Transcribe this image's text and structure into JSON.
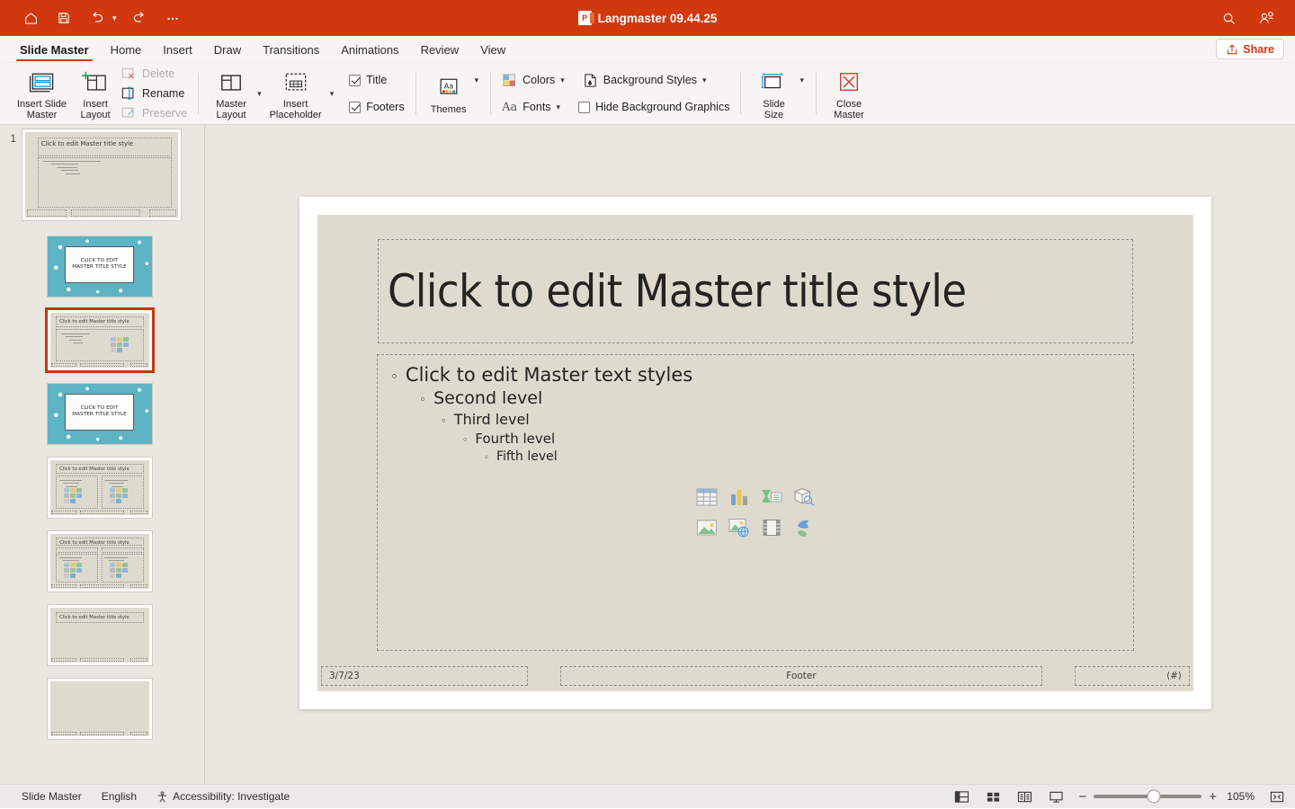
{
  "titlebar": {
    "title": "Langmaster 09.44.25",
    "logo_label": "P",
    "quick_access": [
      {
        "name": "home-icon",
        "label": "Home"
      },
      {
        "name": "save-icon",
        "label": "Save"
      },
      {
        "name": "undo-icon",
        "label": "Undo"
      },
      {
        "name": "redo-icon",
        "label": "Redo"
      },
      {
        "name": "more-options-icon",
        "label": "More Options"
      }
    ],
    "right_icons": [
      {
        "name": "search-icon",
        "label": "Search"
      },
      {
        "name": "account-icon",
        "label": "Account"
      }
    ]
  },
  "tabs": [
    {
      "label": "Slide Master",
      "active": true
    },
    {
      "label": "Home",
      "active": false
    },
    {
      "label": "Insert",
      "active": false
    },
    {
      "label": "Draw",
      "active": false
    },
    {
      "label": "Transitions",
      "active": false
    },
    {
      "label": "Animations",
      "active": false
    },
    {
      "label": "Review",
      "active": false
    },
    {
      "label": "View",
      "active": false
    }
  ],
  "share": {
    "label": "Share"
  },
  "ribbon": {
    "insert_slide_master": "Insert Slide\nMaster",
    "insert_layout": "Insert\nLayout",
    "delete": "Delete",
    "rename": "Rename",
    "preserve": "Preserve",
    "master_layout": "Master\nLayout",
    "insert_placeholder": "Insert\nPlaceholder",
    "title_checkbox": "Title",
    "title_checked": true,
    "footers_checkbox": "Footers",
    "footers_checked": true,
    "themes": "Themes",
    "colors": "Colors",
    "fonts": "Fonts",
    "background_styles": "Background Styles",
    "hide_background_graphics": "Hide Background Graphics",
    "hide_background_checked": false,
    "slide_size": "Slide\nSize",
    "close_master": "Close\nMaster"
  },
  "thumbnails": {
    "master_number": "1",
    "master_title": "Click to edit Master title style",
    "items": [
      {
        "name": "layout-title-slide",
        "type": "teal-title",
        "text": "CLICK TO EDIT\nMASTER TITLE STYLE",
        "selected": false
      },
      {
        "name": "layout-title-and-content",
        "type": "content",
        "title": "Click to edit Master title style",
        "selected": true
      },
      {
        "name": "layout-section-header",
        "type": "teal-title",
        "text": "CLICK TO EDIT\nMASTER TITLE STYLE",
        "selected": false
      },
      {
        "name": "layout-two-content",
        "type": "two-content",
        "title": "Click to edit Master title style",
        "selected": false
      },
      {
        "name": "layout-comparison",
        "type": "two-content",
        "title": "Click to edit Master title style",
        "selected": false
      },
      {
        "name": "layout-title-only",
        "type": "title-only",
        "title": "Click to edit Master title style",
        "selected": false
      },
      {
        "name": "layout-blank",
        "type": "blank",
        "title": "",
        "selected": false
      }
    ]
  },
  "slide": {
    "title_placeholder": "Click to edit Master title style",
    "levels": [
      {
        "bullet": "◦",
        "text": "Click to edit Master text styles"
      },
      {
        "bullet": "◦",
        "text": "Second level"
      },
      {
        "bullet": "◦",
        "text": "Third level"
      },
      {
        "bullet": "◦",
        "text": "Fourth level"
      },
      {
        "bullet": "◦",
        "text": "Fifth level"
      }
    ],
    "content_icons": [
      {
        "name": "insert-table-icon",
        "label": "Insert Table"
      },
      {
        "name": "insert-chart-icon",
        "label": "Insert Chart"
      },
      {
        "name": "insert-smartart-icon",
        "label": "Insert SmartArt"
      },
      {
        "name": "insert-3d-model-icon",
        "label": "Insert 3D Model"
      },
      {
        "name": "insert-picture-icon",
        "label": "Pictures"
      },
      {
        "name": "insert-online-picture-icon",
        "label": "Online Pictures"
      },
      {
        "name": "insert-video-icon",
        "label": "Insert Video"
      },
      {
        "name": "insert-icons-icon",
        "label": "Icons"
      }
    ],
    "footer_date": "3/7/23",
    "footer_text": "Footer",
    "footer_number": "⟨#⟩"
  },
  "statusbar": {
    "view_label": "Slide Master",
    "language": "English",
    "accessibility": "Accessibility: Investigate",
    "views": [
      {
        "name": "normal-view-button",
        "label": "Normal"
      },
      {
        "name": "slide-sorter-button",
        "label": "Slide Sorter"
      },
      {
        "name": "reading-view-button",
        "label": "Reading View"
      },
      {
        "name": "slideshow-button",
        "label": "Slide Show"
      }
    ],
    "zoom_out": "−",
    "zoom_in": "+",
    "zoom_value": "105%",
    "fit_label": "Fit slide to window"
  },
  "colors": {
    "brand_red": "#d2380e",
    "selection_orange": "#c0390e",
    "slide_beige": "#dedbce",
    "workspace": "#e8e6de",
    "teal_pattern": "#5eb4c4"
  }
}
